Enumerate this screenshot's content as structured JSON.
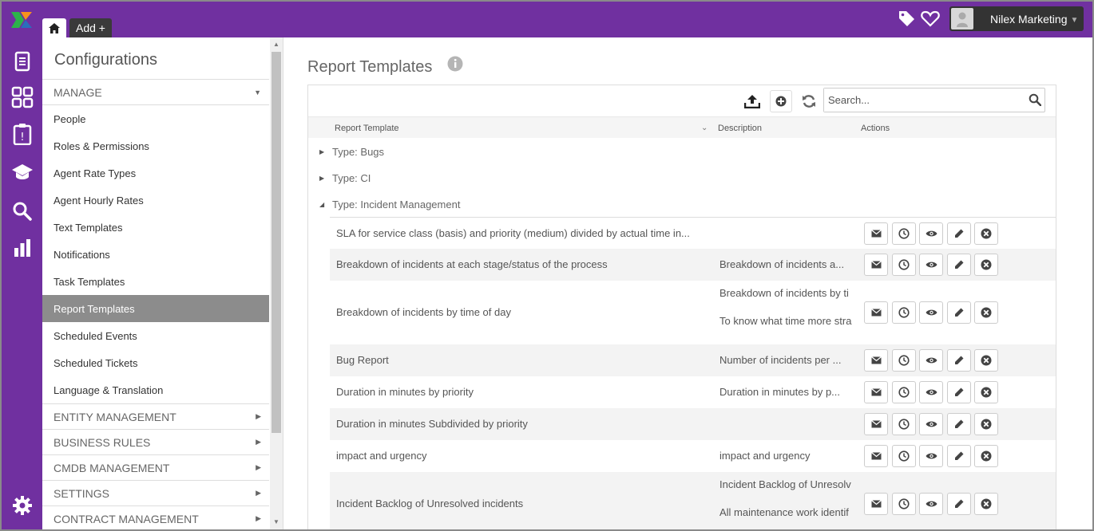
{
  "topbar": {
    "add_tab_label": "Add +",
    "user_name": "Nilex Marketing",
    "brand_color": "#7030a0"
  },
  "rail": {
    "icons": [
      "document-icon",
      "grid-icon",
      "clipboard-icon",
      "graduation-cap-icon",
      "search-icon",
      "bar-chart-icon",
      "gear-icon"
    ]
  },
  "config": {
    "title": "Configurations",
    "manage_label": "MANAGE",
    "items": [
      {
        "label": "People"
      },
      {
        "label": "Roles & Permissions"
      },
      {
        "label": "Agent Rate Types"
      },
      {
        "label": "Agent Hourly Rates"
      },
      {
        "label": "Text Templates"
      },
      {
        "label": "Notifications"
      },
      {
        "label": "Task Templates"
      },
      {
        "label": "Report Templates",
        "active": true
      },
      {
        "label": "Scheduled Events"
      },
      {
        "label": "Scheduled Tickets"
      },
      {
        "label": "Language & Translation"
      }
    ],
    "sections": [
      {
        "label": "ENTITY MANAGEMENT"
      },
      {
        "label": "BUSINESS RULES"
      },
      {
        "label": "CMDB MANAGEMENT"
      },
      {
        "label": "SETTINGS"
      },
      {
        "label": "CONTRACT MANAGEMENT"
      }
    ]
  },
  "main": {
    "title": "Report Templates",
    "search_placeholder": "Search...",
    "columns": {
      "template": "Report Template",
      "description": "Description",
      "actions": "Actions"
    },
    "groups": [
      {
        "label": "Type: Bugs",
        "expanded": false
      },
      {
        "label": "Type: CI",
        "expanded": false
      },
      {
        "label": "Type: Incident Management",
        "expanded": true
      }
    ],
    "rows": [
      {
        "name": "SLA for service class (basis) and priority (medium) divided by actual time in...",
        "desc": []
      },
      {
        "name": "Breakdown of incidents at each stage/status of the process",
        "desc": [
          "Breakdown of incidents a..."
        ]
      },
      {
        "name": "Breakdown of incidents by time of day",
        "desc": [
          "Breakdown of incidents by ti",
          "To know what time more stra"
        ]
      },
      {
        "name": "Bug Report",
        "desc": [
          "Number of incidents per ..."
        ]
      },
      {
        "name": "Duration in minutes by priority",
        "desc": [
          "Duration in minutes by p..."
        ]
      },
      {
        "name": "Duration in minutes Subdivided by priority",
        "desc": []
      },
      {
        "name": "impact and urgency",
        "desc": [
          "impact and urgency"
        ]
      },
      {
        "name": "Incident Backlog of Unresolved incidents",
        "desc": [
          "Incident Backlog of Unresolv",
          "All maintenance work identif"
        ]
      }
    ],
    "row_actions": [
      "envelope-icon",
      "clock-icon",
      "eye-icon",
      "pencil-icon",
      "remove-icon"
    ]
  }
}
